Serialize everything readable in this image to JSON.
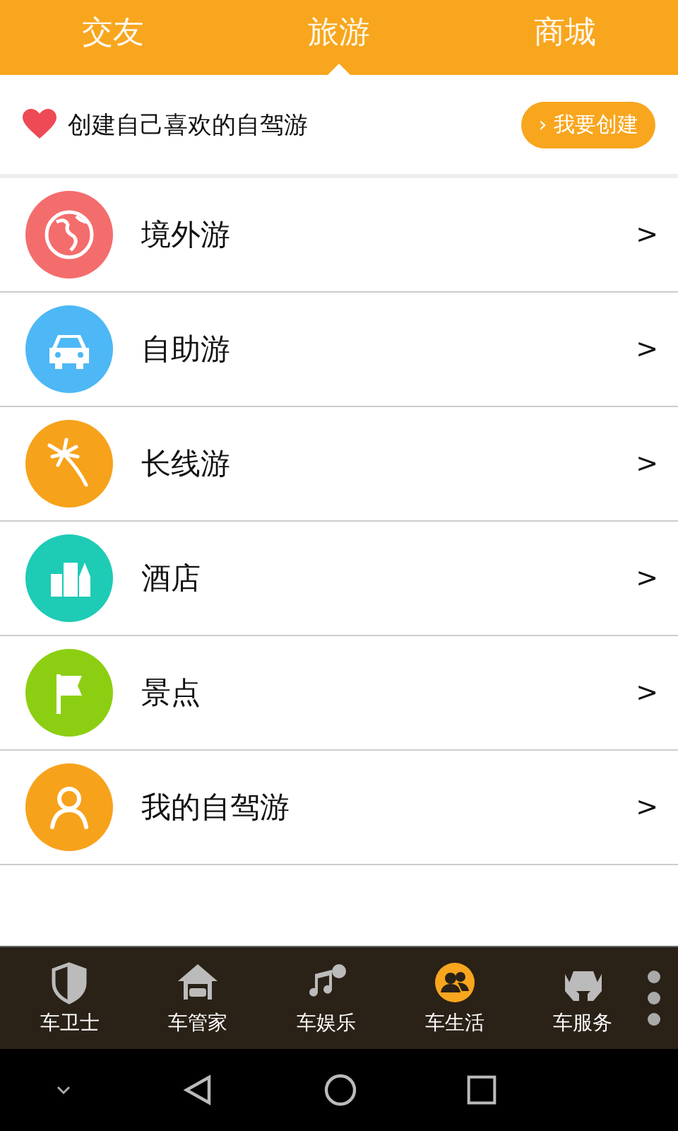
{
  "tabs": [
    {
      "label": "交友",
      "selected": false
    },
    {
      "label": "旅游",
      "selected": true
    },
    {
      "label": "商城",
      "selected": false
    }
  ],
  "banner": {
    "text": "创建自己喜欢的自驾游",
    "button": "› 我要创建"
  },
  "menu": [
    {
      "label": "境外游",
      "kind": "globe",
      "color": "#f46d6d",
      "arrow": ">"
    },
    {
      "label": "自助游",
      "kind": "car",
      "color": "#4db8f5",
      "arrow": ">"
    },
    {
      "label": "长线游",
      "kind": "palm",
      "color": "#f7a21b",
      "arrow": ">"
    },
    {
      "label": "酒店",
      "kind": "buildings",
      "color": "#1ecbb5",
      "arrow": ">"
    },
    {
      "label": "景点",
      "kind": "flag",
      "color": "#8ccf12",
      "arrow": ">"
    },
    {
      "label": "我的自驾游",
      "kind": "person",
      "color": "#f7a21b",
      "arrow": ">"
    }
  ],
  "bottom_tabs": [
    {
      "label": "车卫士",
      "kind": "shield",
      "selected": false
    },
    {
      "label": "车管家",
      "kind": "garage",
      "selected": false
    },
    {
      "label": "车娱乐",
      "kind": "music",
      "selected": false
    },
    {
      "label": "车生活",
      "kind": "people",
      "selected": true
    },
    {
      "label": "车服务",
      "kind": "service",
      "selected": false
    }
  ]
}
